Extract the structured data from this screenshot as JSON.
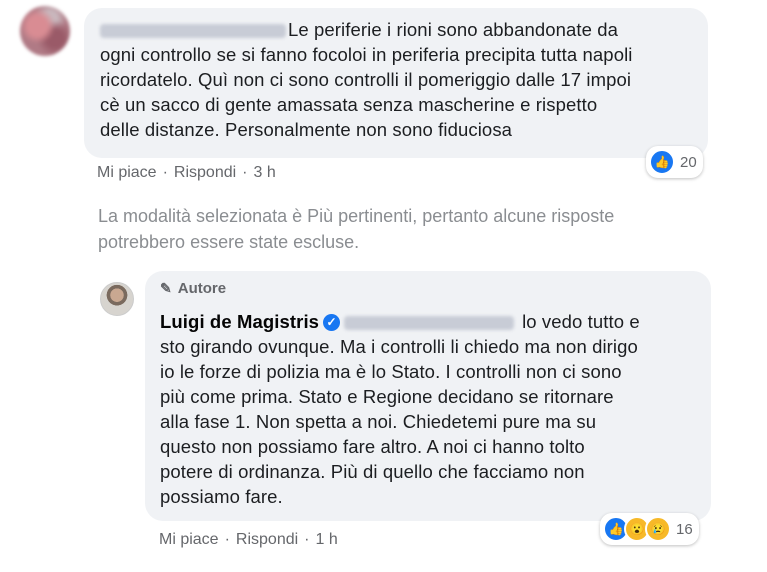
{
  "comment1": {
    "lines": [
      "Le periferie i rioni sono abbandonate da",
      "ogni controllo se si fanno focoloi in periferia precipita tutta napoli",
      "ricordatelo. Quì non ci sono controlli il pomeriggio dalle 17 impoi",
      "cè un sacco di gente amassata senza mascherine e rispetto",
      "delle distanze. Personalmente non sono fiduciosa"
    ],
    "reaction_count": "20",
    "like_label": "Mi piace",
    "reply_label": "Rispondi",
    "time": "3 h"
  },
  "notice": {
    "lines": [
      "La modalità selezionata è Più pertinenti, pertanto alcune risposte",
      "potrebbero essere state escluse."
    ]
  },
  "comment2": {
    "badge": "Autore",
    "author": "Luigi de Magistris",
    "lines": [
      "lo vedo tutto e",
      "sto girando ovunque. Ma i controlli li chiedo ma non dirigo",
      "io le forze di polizia ma è lo Stato. I controlli non ci sono",
      "più come prima. Stato e Regione decidano se ritornare",
      "alla fase 1. Non spetta a noi. Chiedetemi pure ma su",
      "questo non possiamo fare altro. A noi ci hanno tolto",
      "potere di ordinanza. Più di quello che facciamo non",
      "possiamo fare."
    ],
    "reaction_count": "16",
    "like_label": "Mi piace",
    "reply_label": "Rispondi",
    "time": "1 h"
  },
  "icons": {
    "verified": "verified-check-icon",
    "pencil": "pencil-icon",
    "like": "like-reaction-icon",
    "wow": "wow-reaction-icon",
    "sad": "sad-reaction-icon"
  },
  "colors": {
    "bubble": "#f0f2f5",
    "meta_text": "#65676b",
    "notice_text": "#8a8d91",
    "like_blue": "#1877f2"
  }
}
